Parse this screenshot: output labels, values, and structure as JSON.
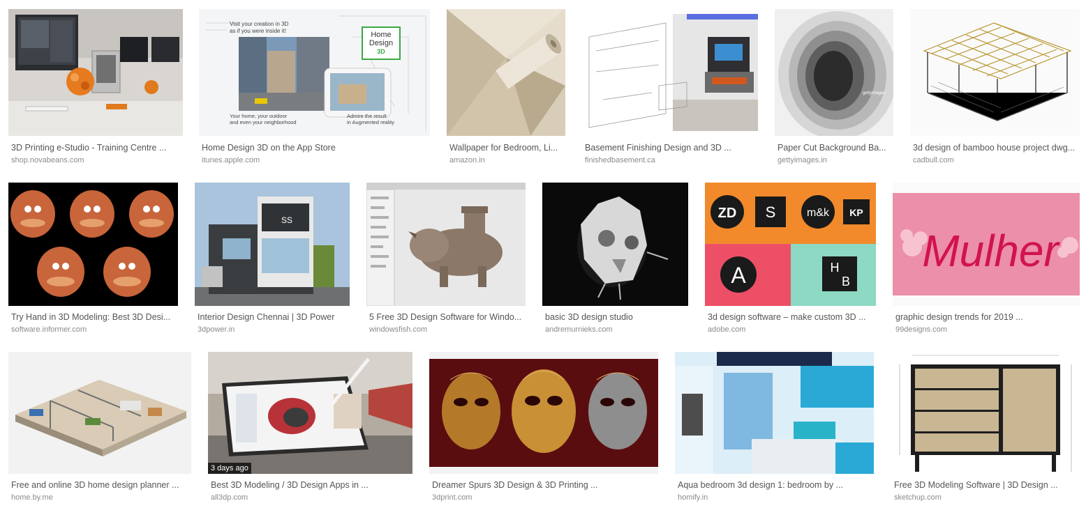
{
  "results": [
    {
      "title": "3D Printing e-Studio - Training Centre ...",
      "source": "shop.novabeans.com",
      "icon": "3d-printer-studio-thumbnail"
    },
    {
      "title": "Home Design 3D on the App Store",
      "source": "itunes.apple.com",
      "icon": "home-design-3d-app-thumbnail",
      "image_text": {
        "top": "Visit your creation in 3D",
        "top2": "as if you were inside it!",
        "logo1": "Home",
        "logo2": "Design",
        "logo3": "3D",
        "left1": "Your home, your outdoor",
        "left2": "and even your neighborhood",
        "right1": "Admire the result",
        "right2": "in Augmented reality"
      }
    },
    {
      "title": "Wallpaper for Bedroom, Li...",
      "source": "amazon.in",
      "icon": "wallpaper-roll-thumbnail"
    },
    {
      "title": "Basement Finishing Design and 3D ...",
      "source": "finishedbasement.ca",
      "icon": "basement-render-thumbnail"
    },
    {
      "title": "Paper Cut Background Ba...",
      "source": "gettyimages.in",
      "icon": "paper-cut-layers-thumbnail",
      "image_text": {
        "watermark": "gettyimages"
      }
    },
    {
      "title": "3d design of bamboo house project dwg...",
      "source": "cadbull.com",
      "icon": "bamboo-house-frame-thumbnail"
    },
    {
      "title": "Try Hand in 3D Modeling: Best 3D Desi...",
      "source": "software.informer.com",
      "icon": "cartoon-heads-thumbnail"
    },
    {
      "title": "Interior Design Chennai | 3D Power",
      "source": "3dpower.in",
      "icon": "building-render-thumbnail",
      "image_text": {
        "sign": "SS"
      }
    },
    {
      "title": "5 Free 3D Design Software for Windo...",
      "source": "windowsfish.com",
      "icon": "triceratops-model-thumbnail"
    },
    {
      "title": "basic 3D design studio",
      "source": "andremurnieks.com",
      "icon": "white-sculpture-thumbnail"
    },
    {
      "title": "3d design software – make custom 3D ...",
      "source": "adobe.com",
      "icon": "logo-monograms-thumbnail",
      "image_text": {
        "m1": "ZD",
        "m2": "S",
        "m3": "m&k",
        "m4": "KP",
        "m5": "A",
        "m6a": "H",
        "m6b": "B"
      }
    },
    {
      "title": "graphic design trends for 2019 ...",
      "source": "99designs.com",
      "icon": "mulher-lettering-thumbnail",
      "image_text": {
        "word": "Mulher"
      }
    },
    {
      "title": "Free and online 3D home design planner ...",
      "source": "home.by.me",
      "icon": "floor-plan-3d-thumbnail"
    },
    {
      "title": "Best 3D Modeling / 3D Design Apps in ...",
      "source": "all3dp.com",
      "icon": "tablet-stylus-thumbnail",
      "badge": "3 days ago"
    },
    {
      "title": "Dreamer Spurs 3D Design & 3D Printing ...",
      "source": "3dprint.com",
      "icon": "ornate-masks-thumbnail"
    },
    {
      "title": "Aqua bedroom 3d design 1: bedroom by ...",
      "source": "homify.in",
      "icon": "aqua-bedroom-thumbnail"
    },
    {
      "title": "Free 3D Modeling Software | 3D Design ...",
      "source": "sketchup.com",
      "icon": "cabinet-drawing-thumbnail"
    }
  ]
}
